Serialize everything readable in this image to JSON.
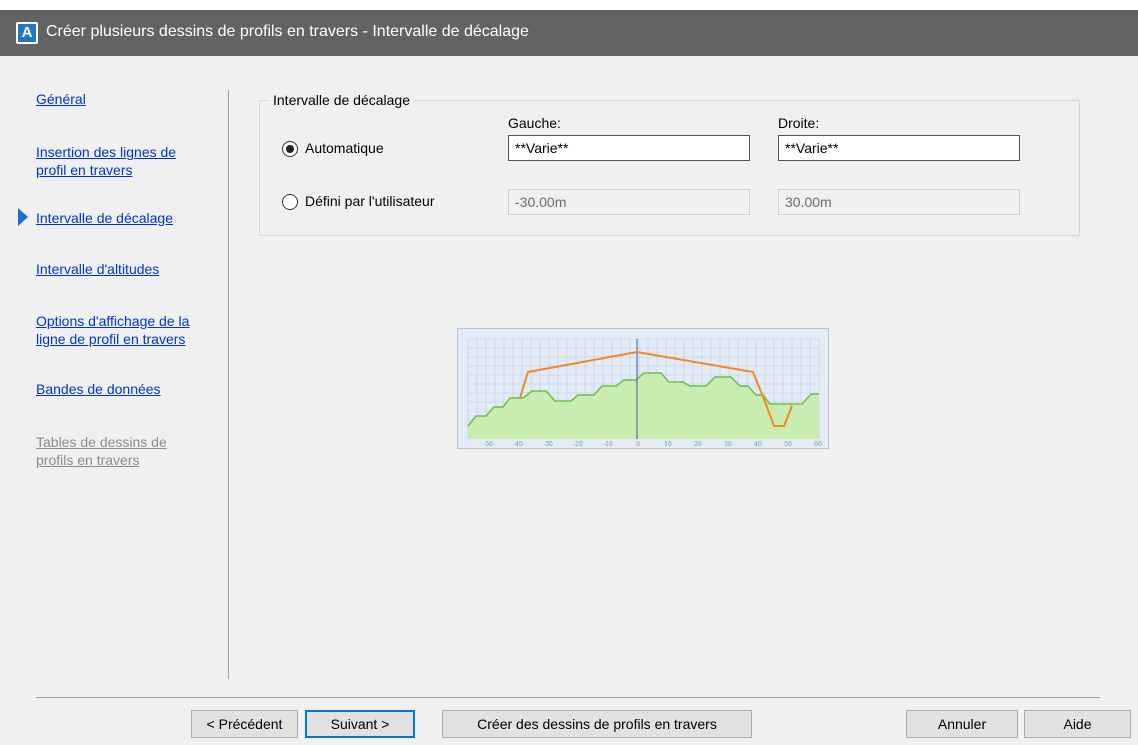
{
  "window": {
    "title": "Créer plusieurs dessins de profils en travers - Intervalle de décalage",
    "app_icon_letter": "A"
  },
  "nav": {
    "items": [
      {
        "label_lines": [
          "Général"
        ]
      },
      {
        "label_lines": [
          "Insertion des lignes de",
          "profil en travers"
        ]
      },
      {
        "label_lines": [
          "Intervalle de décalage"
        ],
        "current": true
      },
      {
        "label_lines": [
          "Intervalle d'altitudes"
        ]
      },
      {
        "label_lines": [
          "Options d'affichage de la",
          "ligne de profil en travers"
        ]
      },
      {
        "label_lines": [
          "Bandes de données"
        ]
      },
      {
        "label_lines": [
          "Tables de dessins de",
          "profils en travers"
        ],
        "disabled": true
      }
    ]
  },
  "offset_range": {
    "group_label": "Intervalle de décalage",
    "left_header": "Gauche:",
    "right_header": "Droite:",
    "automatic": {
      "label": "Automatique",
      "checked": true,
      "left_value": "**Varie**",
      "right_value": "**Varie**"
    },
    "user_defined": {
      "label": "Défini par l'utilisateur",
      "checked": false,
      "left_value": "-30.00m",
      "right_value": "30.00m"
    }
  },
  "preview": {
    "x_ticks": [
      "-50",
      "-40",
      "-30",
      "-20",
      "-10",
      "0",
      "10",
      "20",
      "30",
      "40",
      "50",
      "60"
    ],
    "ground_color": "#6fbf4a",
    "ground_fill": "#c9ecb0",
    "design_color": "#f08a24",
    "grid_color": "#b8cbe6"
  },
  "buttons": {
    "previous": "< Précédent",
    "next": "Suivant >",
    "create": "Créer des dessins de profils en travers",
    "cancel": "Annuler",
    "help": "Aide"
  }
}
